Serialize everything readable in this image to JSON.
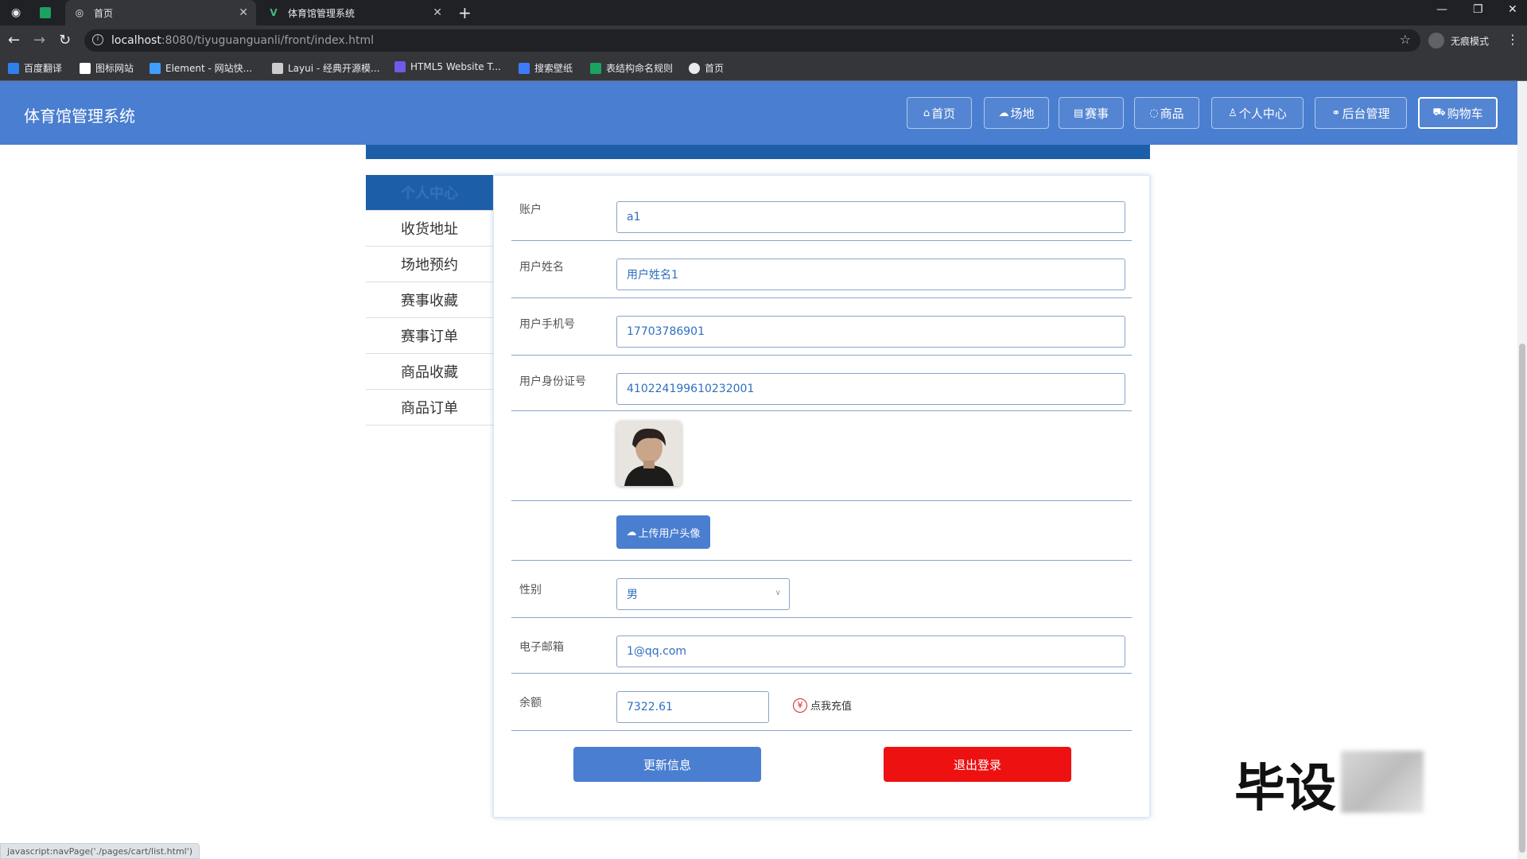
{
  "browser": {
    "tabs": [
      {
        "label": "首页"
      },
      {
        "label": "体育馆管理系统"
      }
    ],
    "address": {
      "host": "localhost",
      "rest": ":8080/tiyuguanguanli/front/index.html"
    },
    "incognito_label": "无痕模式",
    "bookmarks": [
      {
        "label": "百度翻译",
        "color": "#2f80ed"
      },
      {
        "label": "图标网站",
        "color": "#ffffff"
      },
      {
        "label": "Element - 网站快...",
        "color": "#409eff"
      },
      {
        "label": "Layui - 经典开源模...",
        "color": "#cccccc"
      },
      {
        "label": "HTML5 Website T...",
        "color": "#6c5ce7"
      },
      {
        "label": "搜索壁纸",
        "color": "#3d7bfd"
      },
      {
        "label": "表结构命名规则",
        "color": "#1aa260"
      },
      {
        "label": "首页",
        "color": "#e8eaed"
      }
    ]
  },
  "header": {
    "title": "体育馆管理系统",
    "nav": [
      {
        "label": "首页",
        "icon": "home-icon",
        "glyph": "⌂"
      },
      {
        "label": "场地",
        "icon": "venue-icon",
        "glyph": "☁"
      },
      {
        "label": "赛事",
        "icon": "event-icon",
        "glyph": "▤"
      },
      {
        "label": "商品",
        "icon": "goods-icon",
        "glyph": "◌"
      },
      {
        "label": "个人中心",
        "icon": "user-icon",
        "glyph": "♙"
      },
      {
        "label": "后台管理",
        "icon": "link-icon",
        "glyph": "⚭"
      },
      {
        "label": "购物车",
        "icon": "cart-icon",
        "glyph": "⛟"
      }
    ]
  },
  "side_menu": {
    "items": [
      {
        "label": "个人中心"
      },
      {
        "label": "收货地址"
      },
      {
        "label": "场地预约"
      },
      {
        "label": "赛事收藏"
      },
      {
        "label": "赛事订单"
      },
      {
        "label": "商品收藏"
      },
      {
        "label": "商品订单"
      }
    ]
  },
  "form": {
    "account": {
      "label": "账户",
      "value": "a1"
    },
    "name": {
      "label": "用户姓名",
      "value": "用户姓名1"
    },
    "phone": {
      "label": "用户手机号",
      "value": "17703786901"
    },
    "id_card": {
      "label": "用户身份证号",
      "value": "410224199610232001"
    },
    "upload_label": "上传用户头像",
    "gender": {
      "label": "性别",
      "value": "男"
    },
    "email": {
      "label": "电子邮箱",
      "value": "1@qq.com"
    },
    "balance": {
      "label": "余额",
      "value": "7322.61",
      "recharge_label": "点我充值"
    },
    "update_label": "更新信息",
    "logout_label": "退出登录"
  },
  "watermark": "毕设",
  "status_url": "javascript:navPage('./pages/cart/list.html')",
  "colors": {
    "header": "#4a7ed0",
    "accent_dark": "#1d5ea8",
    "logout": "#ee1111"
  }
}
